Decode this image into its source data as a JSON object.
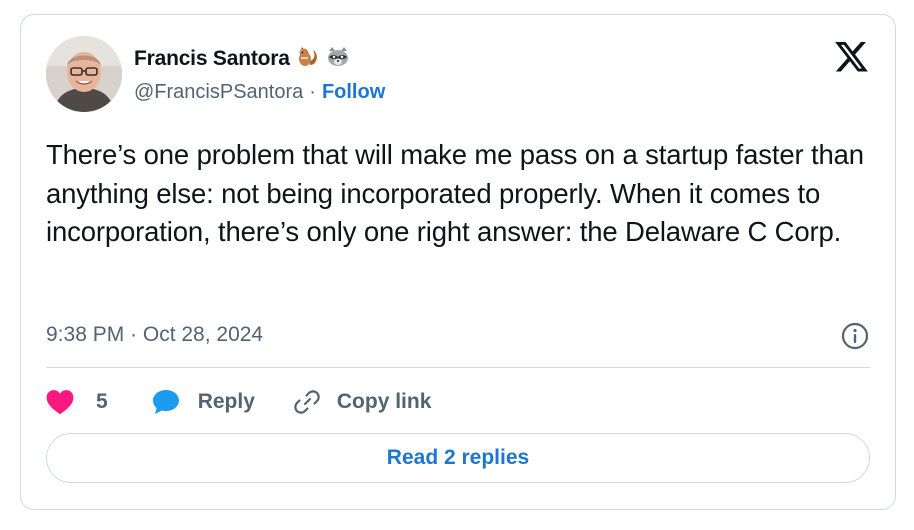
{
  "author": {
    "display_name": "Francis Santora",
    "emojis": [
      "chipmunk-emoji",
      "raccoon-emoji"
    ],
    "handle": "@FrancisPSantora",
    "separator": "·",
    "follow_label": "Follow"
  },
  "tweet": {
    "text": "There’s one problem that will make me pass on a startup faster than anything else: not being incorporated properly. When it comes to incorporation, there’s only one right answer: the Delaware C Corp.",
    "timestamp": "9:38 PM · Oct 28, 2024"
  },
  "actions": {
    "like_count": "5",
    "reply_label": "Reply",
    "copy_label": "Copy link"
  },
  "read_replies_label": "Read 2 replies",
  "colors": {
    "text": "#0f1419",
    "secondary": "#536471",
    "link": "#1d76d0",
    "like": "#f91880",
    "reply_icon": "#1d9bf0",
    "border": "#cfd9de"
  },
  "icons": [
    "x-logo-icon",
    "info-icon",
    "heart-icon",
    "speech-bubble-icon",
    "link-icon"
  ]
}
